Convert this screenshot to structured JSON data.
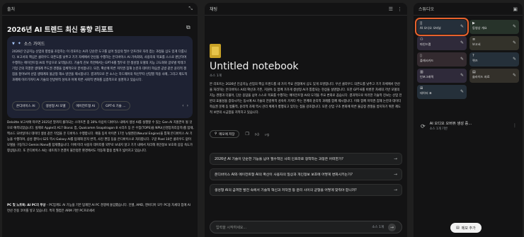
{
  "left": {
    "header": "출처",
    "title": "2026년 AI 트렌드 최신 동향 리포트",
    "guide_title": "소스 가이드",
    "guide_text": "2026년 인공지능 산업의 향방을 조망하는 이 리포트는 AI가 단순한 도구를 넘어 일상의 필수 인프라로 자리 잡는 과정을 심도 있게 다룹니다. 보고서의 핵심은 클라우드 의존도를 낮추고 기기 자체에서 연산을 수행하는 온디바이스 AI 가속화와, 사용자의 목표를 스스로 판단하여 수행하는 에이전트형 AI의 부상으로 요약됩니다. 기술적 진보 측면에서는 GPT-6를 필두로 한 생성형 모델의 지능 고도화와 글로벌 빅테크 기업 간의 치열한 생태계 주도권 경쟁을 입체적으로 분석합니다. 또한, 확산에 따른 저작권 침해 논란과 데이터 학습권 공방 같은 윤리적 쟁점을 짚어보며 산업 생태계의 불균형 해소 방안을 제시합니다. 결과적으로 본 소스는 하드웨어의 혁신부터 산업별 적용 사례, 그리고 제도적 과제에 이르기까지 AI 기술의 전방위적 성숙과 이에 따른 사회적 변화를 심층적으로 설명하고 있습니다.",
    "chips": [
      "온디바이스 AI",
      "생성형 AI 모델",
      "에이전트형 AI",
      "GPT-6 기술 ..."
    ],
    "body": "Deloitte 보고서에 따르면 2025년 말까지 출하되는 스마트폰 중 30% 이상이 디바이스 내에서 생성 AI를 실행할 수 있는 Gen AI 지원폰이 될 것으로 예측되었습니다. 실제로 Apple의 A17 Bionic 칩, Qualcomm Snapdragon 8 시리즈 등 온 수칩(TOPS)을 NPU(신경망처리장치)를 탑재, 엑소드 모바일이나 데이터 생성 같은 작업을 온 디바이스 수행합니다. 애플 등이 아이폰 17인 뉴럴엔진(Neural Engine)을 통해 온디바이스 AI 기능을 수행하며, 삼성 갤럭시 S25 역시 Galaxy AI를 탑재해 문자 번역, 사진 편집 등을 온디바이스로 처리합니다. 구글 Pixel 10은 클라우드 없이 모델을 구동하고 Gemini Nano를 탑재했습니다. 이에 따라 사용자 데이터를 외부로 보내지 않고 기기 내에서 처리해 개인정보 보호와 응답 속도가 향상됩니다. 또 온디바이스 AI는 네트워크 연결이 불안정한 환경에서도 작동해 활용 범위가 넓어지고 있습니다.",
    "body2_bold": "PC 및 노트북: AI PC의 부상",
    "body2": " – PC업계도 AI 기능을 기본 탑재한 AI PC 경쟁에 돌입했습니다. 인텔, AMD, 엔비디아 모두 PC용 차세대 칩에 AI 연산 전용 코어를 넣고 있습니다. 특히 퀄컴은 ARM 기반 PC프로세서"
  },
  "middle": {
    "header": "채팅",
    "title": "Untitled notebook",
    "sources": "소스 1개",
    "body": "본 리포트는 2026년 인공지능 산업의 핵심 트렌드를 네 가지 주요 관점에서 심도 있게 조명합니다. 우선 클라우드 의존도를 낮추고 기기 자체에서 연산을 처리하는 온디바이스 AI의 확산과 기존, 지원속 등 함께 가가게 생성형 AI가 통합되는 현상을 설명합니다. 또한 GPT-6를 비롯한 차세대 기반 모델의 지능 경쟁과 더불어, 단순 응답을 넘어 스스로 목표를 수행하는 에이전트형 AI의 도약을 주요 변화로 꼽습니다. 결과적으로 이러한 기술적 진보는 산업 전반의 효율성을 증대시키는 동시에 AI 기술의 전방위적 성숙이 가져다 주는 한계와 윤리적 과제를 함께 제시합니다. 이와 함께 저작권 침해 논란과 데이터 학습권 문제 등 법률적, 윤리적 과제 역시 관리 체계가 병행되고 있다는 점을 강조합니다. 또한 산업 구조 변화에 따른 불공정 경쟁을 방지하기 위한 제도적 보완의 시급함을 지적하고 있습니다.",
    "save_label": "메모에 저장",
    "questions": [
      "2026년 AI 기술이 단순한 기능을 넘어 필수적인 사회 인프라로 정착하는 과정은 어떠한가?",
      "온디바이스 AI와 에이전트형 AI의 확산이 사용자의 일상과 개인정보 보호에 어떻게 변화시키는가?",
      "생성형 AI의 급격한 발전 속에서 기술적 혁신과 저작권 등 윤리 사이의 균형을 어떻게 맞춰야 합니까?"
    ],
    "input_placeholder": "입력을 시작하세요...",
    "input_sources": "소스 1개"
  },
  "right": {
    "header": "스튜디오",
    "tiles": [
      {
        "label": "AI 오디오 오버뷰",
        "color": "#252f3a",
        "icon": "||"
      },
      {
        "label": "동영상 개요",
        "color": "#27332a",
        "icon": "▶"
      },
      {
        "label": "마인드맵",
        "color": "#2f2a3a",
        "icon": "⚇"
      },
      {
        "label": "보고서",
        "color": "#33322a",
        "icon": "≡"
      },
      {
        "label": "플래시카드",
        "color": "#332a2f",
        "icon": "▯"
      },
      {
        "label": "퀴즈",
        "color": "#25303a",
        "icon": "?"
      },
      {
        "label": "인포그래픽",
        "color": "#2f2a3a",
        "icon": "▥"
      },
      {
        "label": "슬라이드 자료",
        "color": "#33302a",
        "icon": "▤"
      },
      {
        "label": "데이터 표",
        "color": "#25303a",
        "icon": "⊞"
      }
    ],
    "gen_title": "AI 오디오 오버뷰 생성 중...",
    "gen_sub": "소스 1개 기반",
    "memo_label": "메모 추가"
  }
}
